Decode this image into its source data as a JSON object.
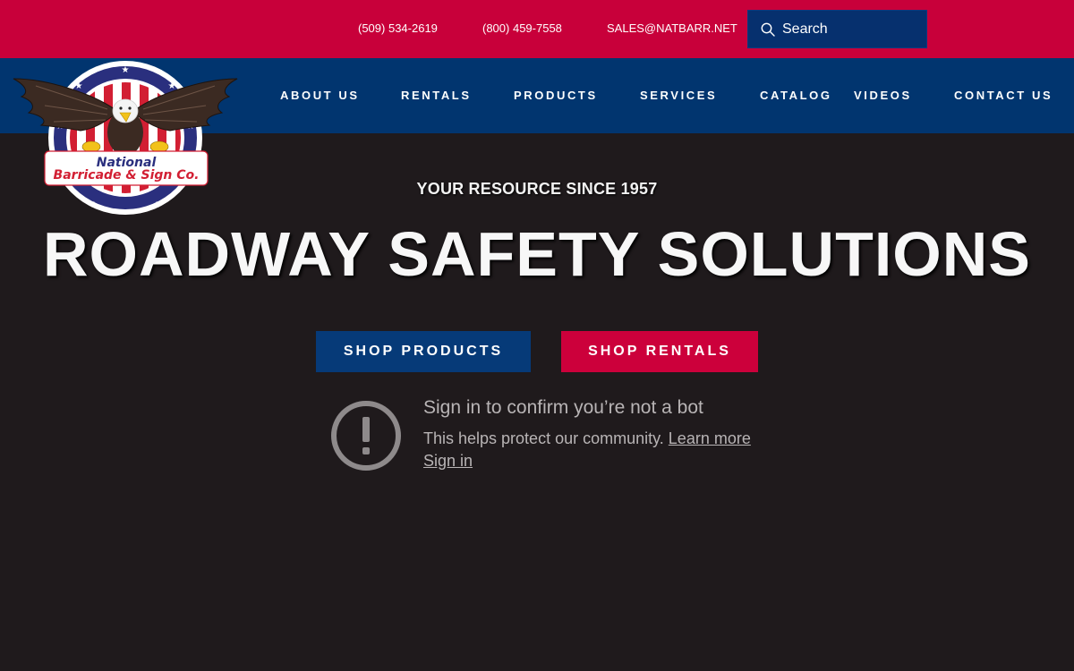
{
  "topbar": {
    "phone1": "(509) 534-2619",
    "phone2": "(800) 459-7558",
    "email": "SALES@NATBARR.NET",
    "search_placeholder": "Search"
  },
  "nav": {
    "about": "ABOUT US",
    "rentals": "RENTALS",
    "products": "PRODUCTS",
    "services": "SERVICES",
    "catalog": "CATALOG",
    "videos": "VIDEOS",
    "contact": "CONTACT US"
  },
  "logo": {
    "line1": "National",
    "line2": "Barricade & Sign Co."
  },
  "hero": {
    "tagline": "YOUR RESOURCE SINCE 1957",
    "headline": "ROADWAY SAFETY SOLUTIONS",
    "shop_products": "SHOP PRODUCTS",
    "shop_rentals": "SHOP RENTALS"
  },
  "bot_notice": {
    "title": "Sign in to confirm you’re not a bot",
    "text": "This helps protect our community.",
    "learn_more": "Learn more",
    "sign_in": "Sign in"
  },
  "colors": {
    "topbar_red": "#c8003a",
    "nav_blue": "#01356f",
    "page_bg": "#1f1a1c"
  }
}
